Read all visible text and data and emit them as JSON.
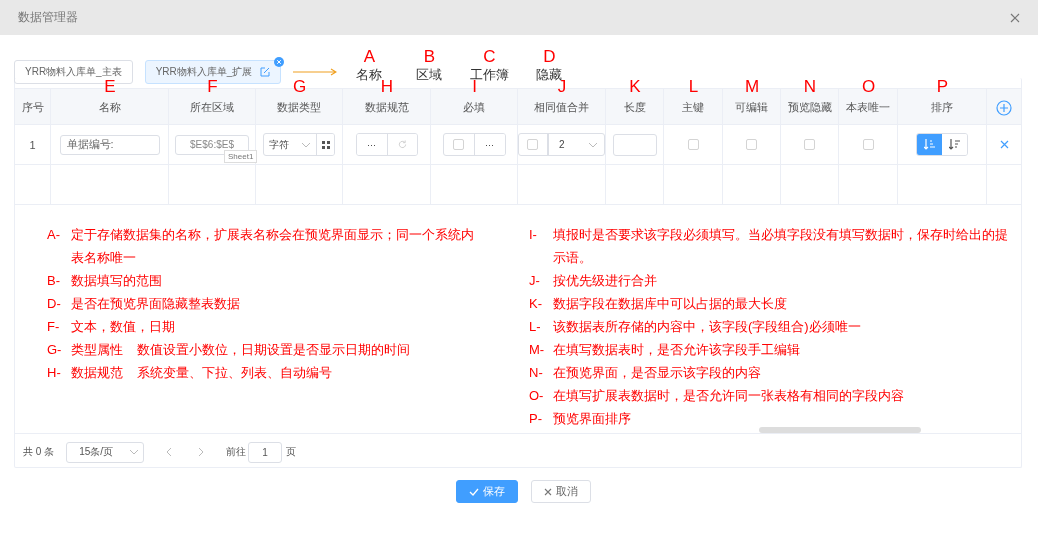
{
  "window": {
    "title": "数据管理器"
  },
  "sheet_tabs": [
    {
      "label": "YRR物料入库单_主表",
      "selected": false
    },
    {
      "label": "YRR物料入库单_扩展",
      "selected": true
    }
  ],
  "tab_annotations": [
    {
      "letter": "A",
      "label": "名称"
    },
    {
      "letter": "B",
      "label": "区域"
    },
    {
      "letter": "C",
      "label": "工作簿"
    },
    {
      "letter": "D",
      "label": "隐藏"
    }
  ],
  "table": {
    "columns": [
      {
        "label": "序号"
      },
      {
        "label": "名称",
        "letter": "E"
      },
      {
        "label": "所在区域",
        "letter": "F"
      },
      {
        "label": "数据类型",
        "letter": "G"
      },
      {
        "label": "数据规范",
        "letter": "H"
      },
      {
        "label": "必填",
        "letter": "I"
      },
      {
        "label": "相同值合并",
        "letter": "J"
      },
      {
        "label": "长度",
        "letter": "K"
      },
      {
        "label": "主键",
        "letter": "L"
      },
      {
        "label": "可编辑",
        "letter": "M"
      },
      {
        "label": "预览隐藏",
        "letter": "N"
      },
      {
        "label": "本表唯一",
        "letter": "O"
      },
      {
        "label": "排序",
        "letter": "P"
      }
    ],
    "rows": [
      {
        "index": "1",
        "name": "单据编号:",
        "range": "$E$6:$E$",
        "range_tooltip": "Sheet1",
        "data_type": "字符",
        "spec_button": "···",
        "required": false,
        "required_button": "···",
        "merge": false,
        "merge_level": "2",
        "primary_key": false,
        "editable": false,
        "preview_hidden": false,
        "unique": false,
        "sort": [
          {
            "kind": "ascending",
            "selected": true
          },
          {
            "kind": "descending",
            "selected": false
          }
        ]
      }
    ]
  },
  "notes_left": [
    {
      "letter": "A-",
      "text": "定于存储数据集的名称，扩展表名称会在预览界面显示；同一个系统内表名称唯一"
    },
    {
      "letter": "B-",
      "text": "数据填写的范围"
    },
    {
      "letter": "D-",
      "text": "是否在预览界面隐藏整表数据"
    },
    {
      "letter": "F-",
      "text": "文本，数值，日期"
    },
    {
      "letter": "G-",
      "text": "类型属性    数值设置小数位，日期设置是否显示日期的时间"
    },
    {
      "letter": "H-",
      "text": "数据规范    系统变量、下拉、列表、自动编号"
    }
  ],
  "notes_right": [
    {
      "letter": "I-",
      "text": "填报时是否要求该字段必须填写。当必填字段没有填写数据时，保存时给出的提示语。"
    },
    {
      "letter": "J-",
      "text": "按优先级进行合并"
    },
    {
      "letter": "K-",
      "text": "数据字段在数据库中可以占据的最大长度"
    },
    {
      "letter": "L-",
      "text": "该数据表所存储的内容中，该字段(字段组合)必须唯一"
    },
    {
      "letter": "M-",
      "text": "在填写数据表时，是否允许该字段手工编辑"
    },
    {
      "letter": "N-",
      "text": "在预览界面，是否显示该字段的内容"
    },
    {
      "letter": "O-",
      "text": "在填写扩展表数据时，是否允许同一张表格有相同的字段内容"
    },
    {
      "letter": "P-",
      "text": "预览界面排序"
    }
  ],
  "pagination": {
    "total": "共 0 条",
    "page_size": "15条/页",
    "goto_label": "前往",
    "page": "1",
    "page_suffix": "页"
  },
  "footer": [
    {
      "kind": "primary",
      "label": "保存"
    },
    {
      "kind": "cancel",
      "label": "取消"
    }
  ]
}
